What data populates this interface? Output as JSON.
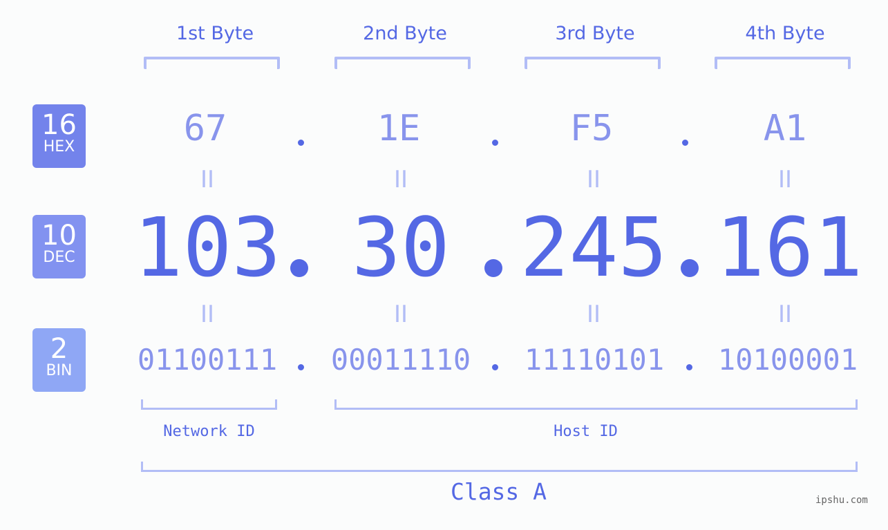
{
  "bytes": [
    {
      "label": "1st Byte",
      "hex": "67",
      "dec": "103",
      "bin": "01100111"
    },
    {
      "label": "2nd Byte",
      "hex": "1E",
      "dec": "30",
      "bin": "00011110"
    },
    {
      "label": "3rd Byte",
      "hex": "F5",
      "dec": "245",
      "bin": "11110101"
    },
    {
      "label": "4th Byte",
      "hex": "A1",
      "dec": "161",
      "bin": "10100001"
    }
  ],
  "badges": {
    "hex": {
      "num": "16",
      "label": "HEX",
      "color": "#7383eb"
    },
    "dec": {
      "num": "10",
      "label": "DEC",
      "color": "#8292f0"
    },
    "bin": {
      "num": "2",
      "label": "BIN",
      "color": "#8fa7f5"
    }
  },
  "equals_glyph": "II",
  "network_id_label": "Network ID",
  "host_id_label": "Host ID",
  "class_label": "Class A",
  "watermark": "ipshu.com",
  "colors": {
    "primary": "#5468e4",
    "secondary": "#8894ec",
    "bracket": "#b2bdf6",
    "background": "#fbfcfc"
  }
}
